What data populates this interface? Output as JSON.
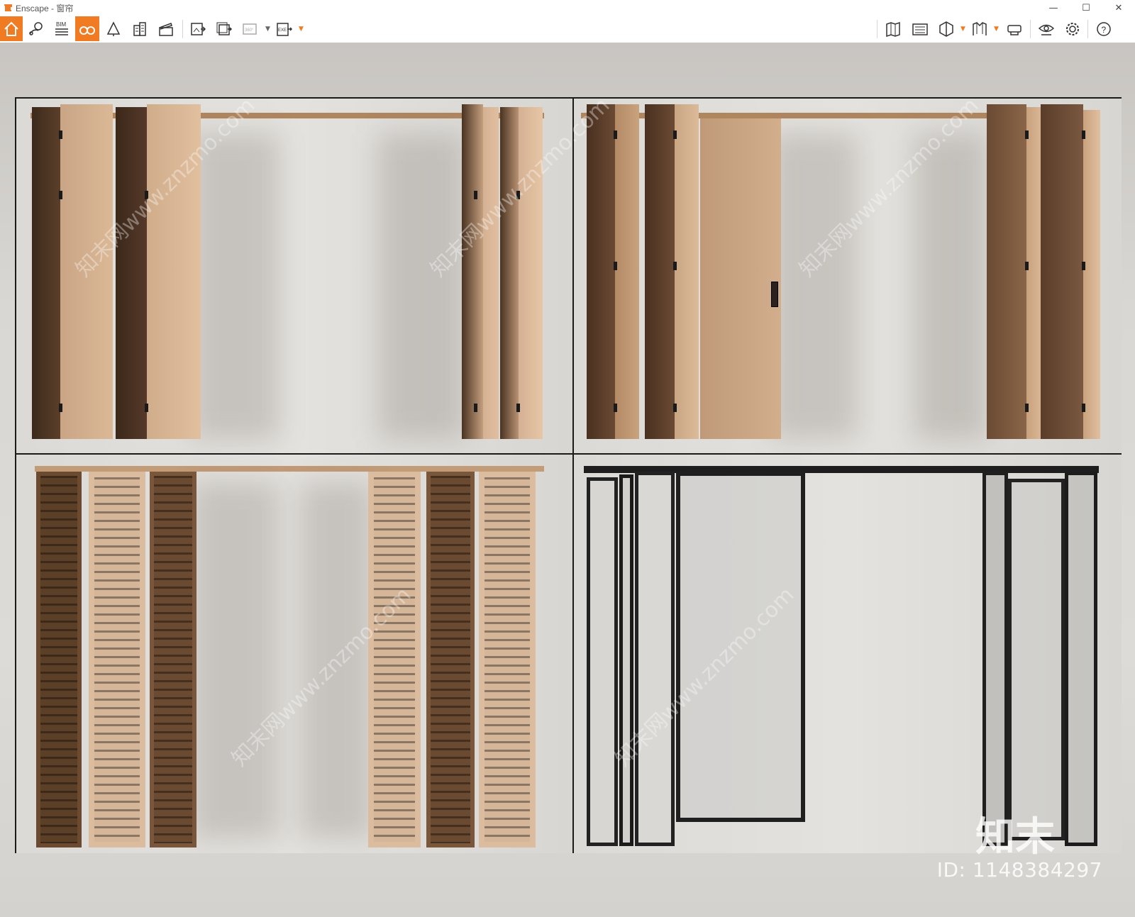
{
  "window": {
    "title": "Enscape - 窗帘",
    "minimize": "—",
    "maximize": "☐",
    "close": "✕"
  },
  "toolbar": {
    "bim_label": "BIM",
    "pano_label": "360°",
    "exe_label": "EXE",
    "accent": "#f07b22"
  },
  "viewport": {
    "watermark_id": "ID: 1148384297",
    "logo_text": "知末",
    "diagonal_watermark": "知末网www.znzmo.com"
  }
}
